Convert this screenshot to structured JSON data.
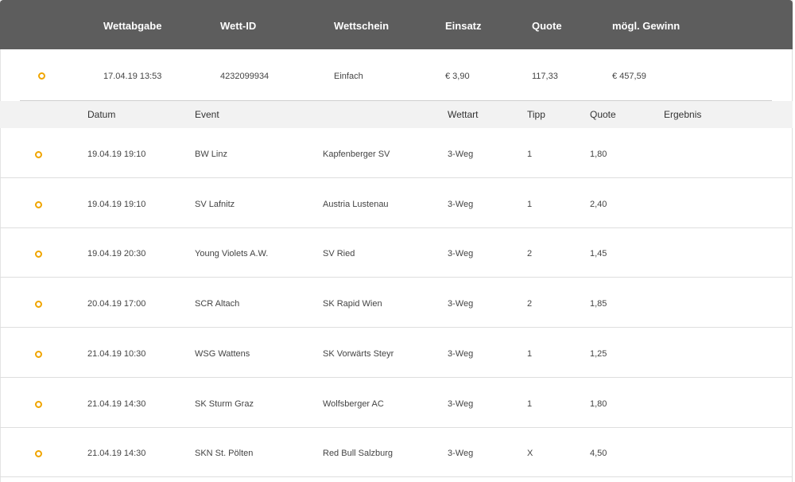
{
  "header": {
    "wettabgabe": "Wettabgabe",
    "wett_id": "Wett-ID",
    "wettschein": "Wettschein",
    "einsatz": "Einsatz",
    "quote": "Quote",
    "gewinn": "mögl. Gewinn"
  },
  "summary": {
    "status_icon": "pending-circle-icon",
    "wettabgabe": "17.04.19 13:53",
    "wett_id": "4232099934",
    "wettschein": "Einfach",
    "einsatz": "€ 3,90",
    "quote": "117,33",
    "gewinn": "€ 457,59"
  },
  "subheader": {
    "datum": "Datum",
    "event": "Event",
    "wettart": "Wettart",
    "tipp": "Tipp",
    "quote": "Quote",
    "ergebnis": "Ergebnis"
  },
  "rows": [
    {
      "datum": "19.04.19 19:10",
      "home": "BW Linz",
      "away": "Kapfenberger SV",
      "wettart": "3-Weg",
      "tipp": "1",
      "quote": "1,80",
      "ergebnis": ""
    },
    {
      "datum": "19.04.19 19:10",
      "home": "SV Lafnitz",
      "away": "Austria Lustenau",
      "wettart": "3-Weg",
      "tipp": "1",
      "quote": "2,40",
      "ergebnis": ""
    },
    {
      "datum": "19.04.19 20:30",
      "home": "Young Violets A.W.",
      "away": "SV Ried",
      "wettart": "3-Weg",
      "tipp": "2",
      "quote": "1,45",
      "ergebnis": ""
    },
    {
      "datum": "20.04.19 17:00",
      "home": "SCR Altach",
      "away": "SK Rapid Wien",
      "wettart": "3-Weg",
      "tipp": "2",
      "quote": "1,85",
      "ergebnis": ""
    },
    {
      "datum": "21.04.19 10:30",
      "home": "WSG Wattens",
      "away": "SK Vorwärts Steyr",
      "wettart": "3-Weg",
      "tipp": "1",
      "quote": "1,25",
      "ergebnis": ""
    },
    {
      "datum": "21.04.19 14:30",
      "home": "SK Sturm Graz",
      "away": "Wolfsberger AC",
      "wettart": "3-Weg",
      "tipp": "1",
      "quote": "1,80",
      "ergebnis": ""
    },
    {
      "datum": "21.04.19 14:30",
      "home": "SKN St. Pölten",
      "away": "Red Bull Salzburg",
      "wettart": "3-Weg",
      "tipp": "X",
      "quote": "4,50",
      "ergebnis": ""
    }
  ],
  "colors": {
    "header_bg": "#5d5d5d",
    "subheader_bg": "#f2f2f2",
    "status_pending": "#f0a500"
  }
}
